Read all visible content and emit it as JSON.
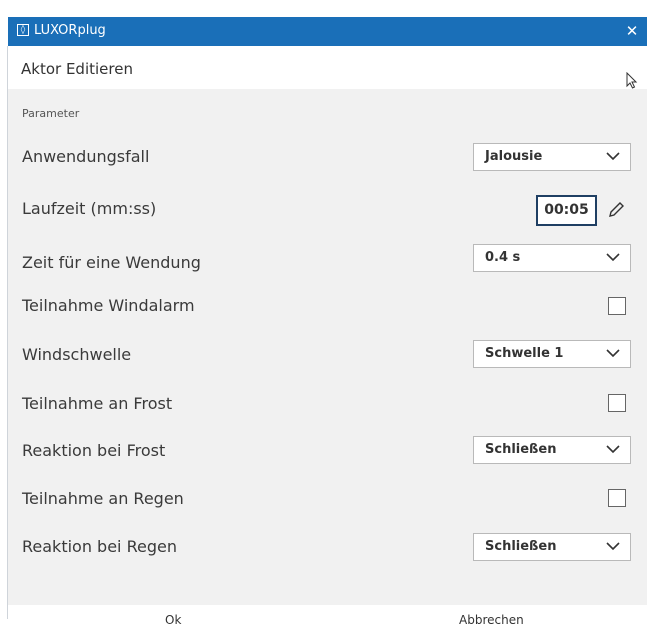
{
  "window": {
    "title": "LUXORplug",
    "close_glyph": "✕"
  },
  "subheader": {
    "title": "Aktor Editieren"
  },
  "section": {
    "label": "Parameter"
  },
  "rows": [
    {
      "label": "Anwendungsfall",
      "control": "select",
      "value": "Jalousie"
    },
    {
      "label": "Laufzeit (mm:ss)",
      "control": "time",
      "value": "00:05"
    },
    {
      "label": "Zeit für eine Wendung",
      "control": "select",
      "value": "0.4 s"
    },
    {
      "label": "Teilnahme Windalarm",
      "control": "checkbox",
      "checked": false
    },
    {
      "label": "Windschwelle",
      "control": "select",
      "value": "Schwelle 1"
    },
    {
      "label": "Teilnahme an Frost",
      "control": "checkbox",
      "checked": false
    },
    {
      "label": "Reaktion bei Frost",
      "control": "select",
      "value": "Schließen"
    },
    {
      "label": "Teilnahme an Regen",
      "control": "checkbox",
      "checked": false
    },
    {
      "label": "Reaktion bei Regen",
      "control": "select",
      "value": "Schließen"
    }
  ],
  "footer": {
    "ok_label": "Ok",
    "cancel_label": "Abbrechen"
  },
  "colors": {
    "titlebar": "#1a6fb8",
    "accent_border": "#1f3f63"
  }
}
